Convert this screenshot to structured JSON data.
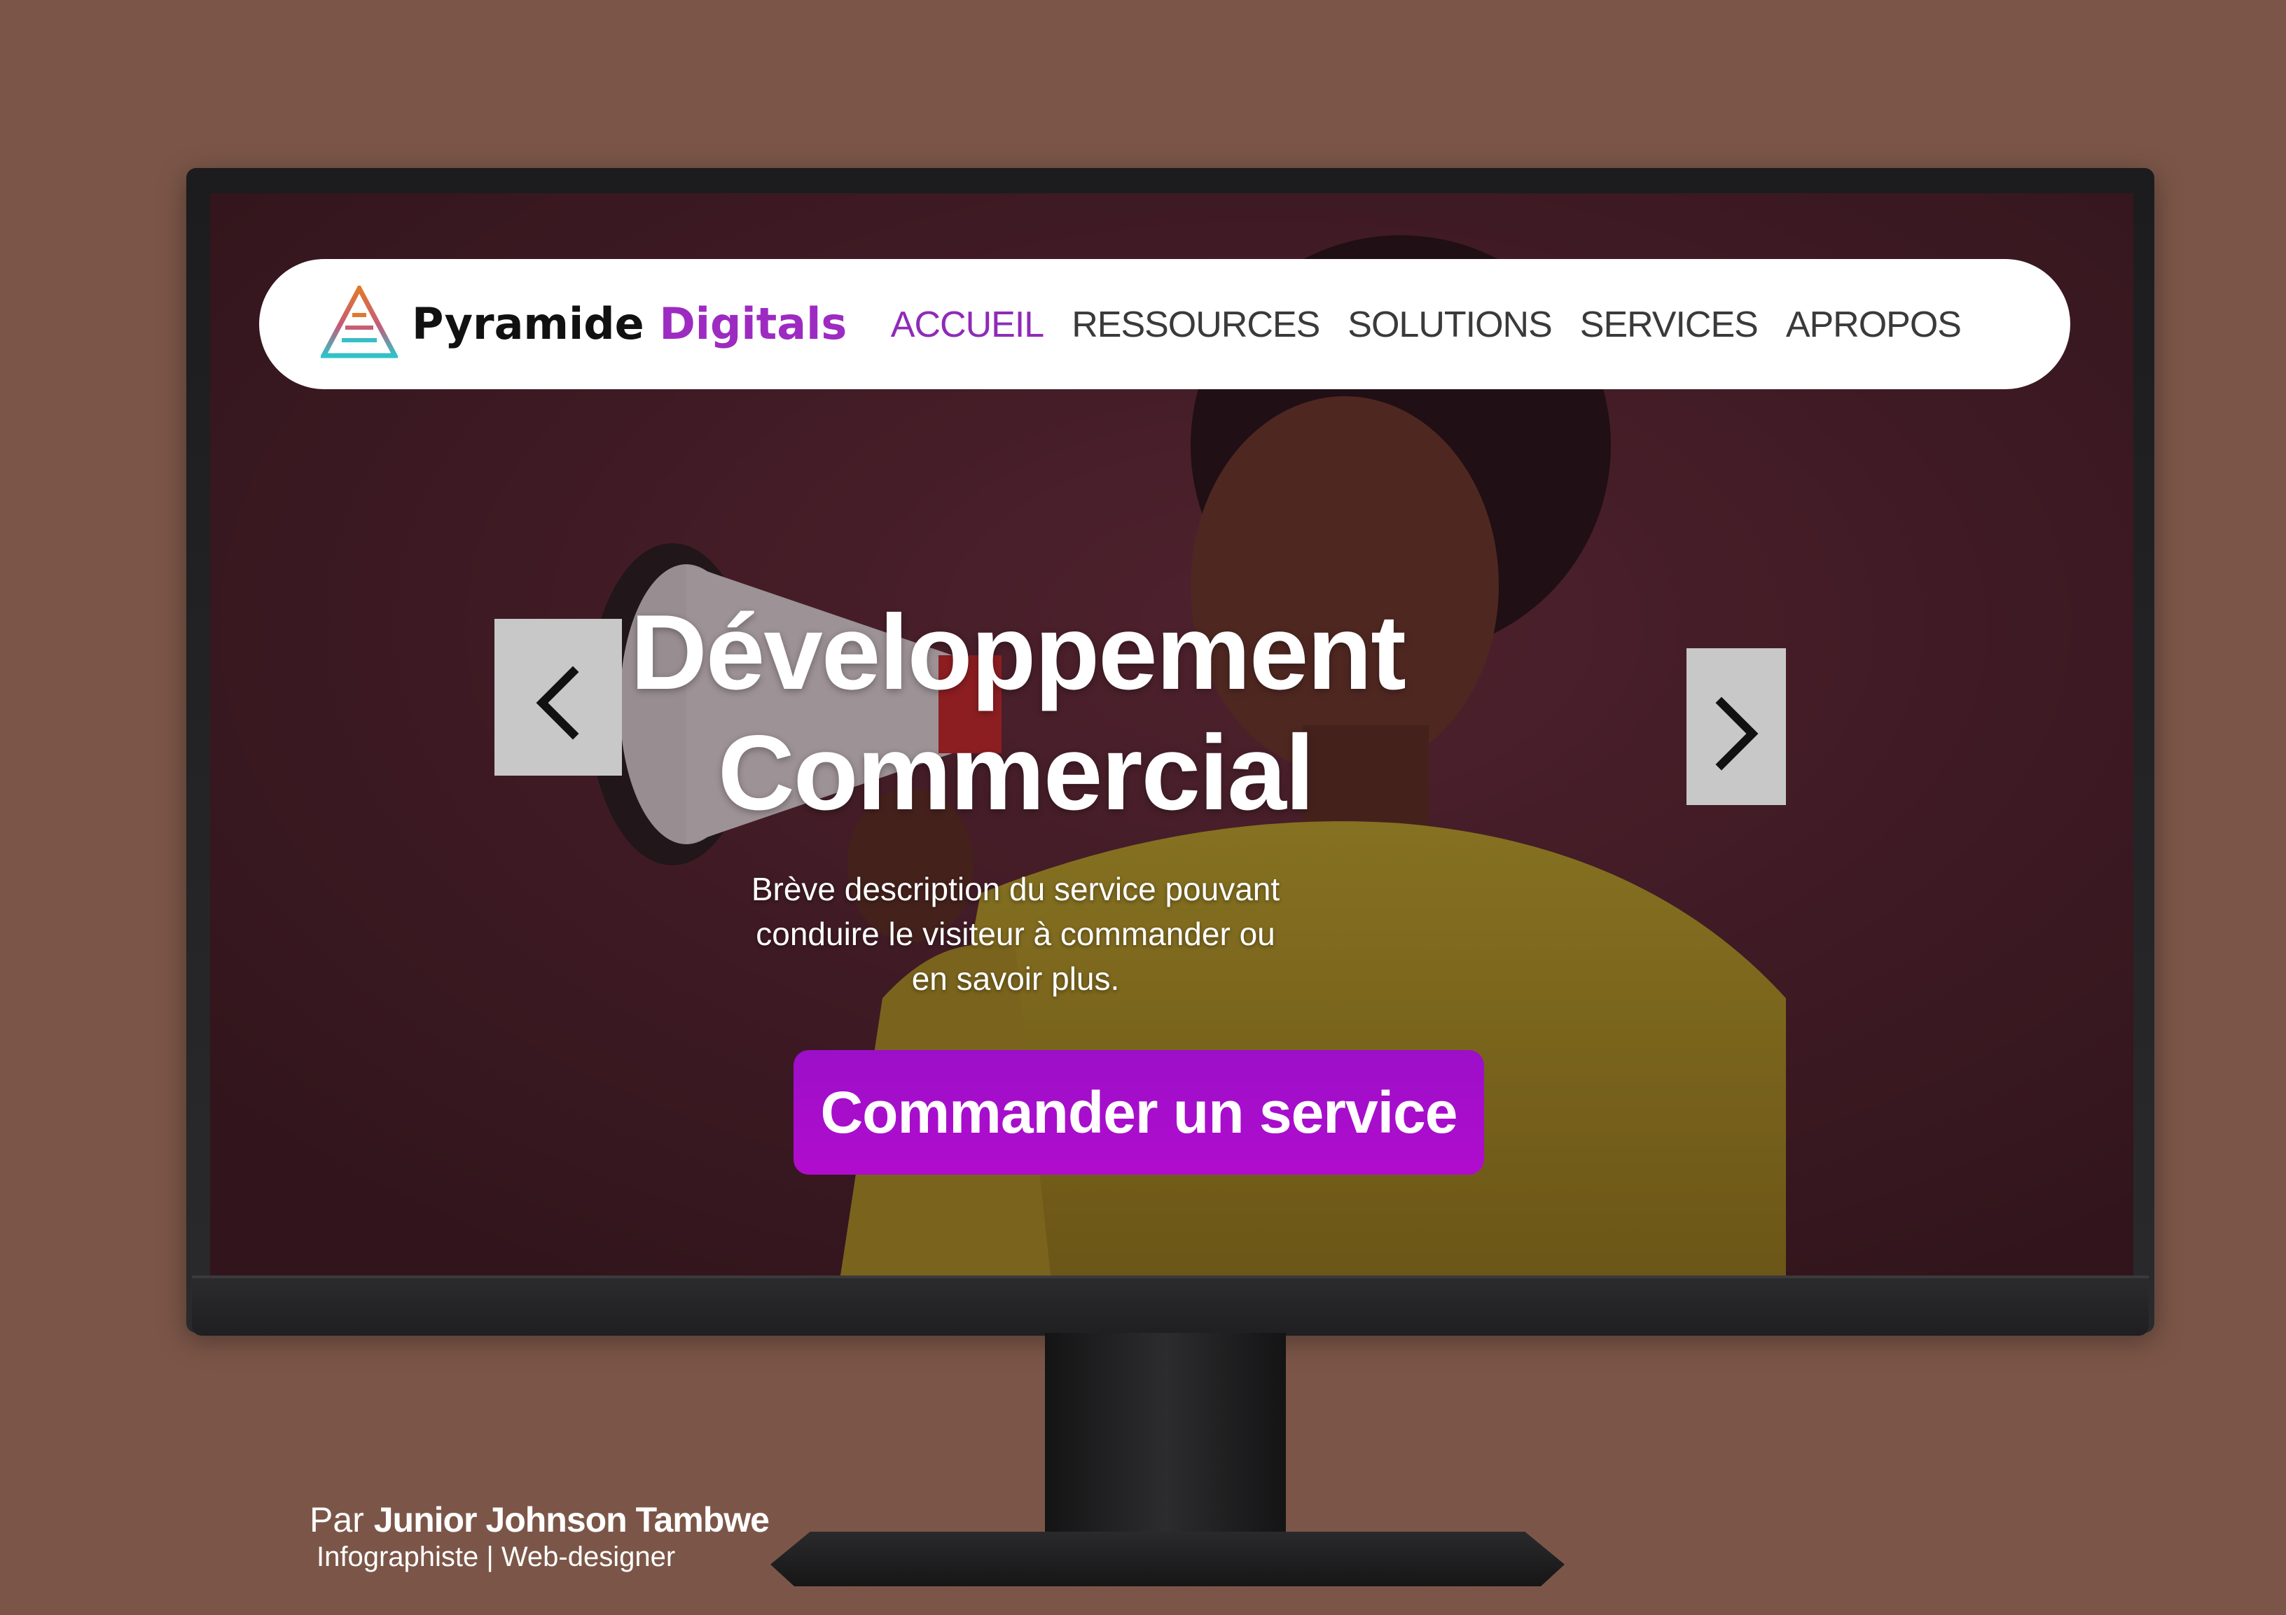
{
  "navbar": {
    "brand_part1": "Pyramide",
    "brand_part2": "Digitals",
    "items": [
      {
        "label": "ACCUEIL",
        "active": true
      },
      {
        "label": "RESSOURCES",
        "active": false
      },
      {
        "label": "SOLUTIONS",
        "active": false
      },
      {
        "label": "SERVICES",
        "active": false
      },
      {
        "label": "APROPOS",
        "active": false
      }
    ]
  },
  "hero": {
    "title_line1": "Développement",
    "title_line2": "Commercial",
    "description": "Brève description du service pouvant conduire le visiteur à commander ou en savoir plus.",
    "cta_label": "Commander un service",
    "prev_icon": "chevron-left-icon",
    "next_icon": "chevron-right-icon"
  },
  "credits": {
    "prefix": "Par",
    "name": "Junior Johnson Tambwe",
    "role": "Infographiste | Web-designer"
  },
  "colors": {
    "background": "#7b5648",
    "accent": "#9d2bc2",
    "cta": "#a80ecb",
    "hero_bg": "#4a2230"
  }
}
